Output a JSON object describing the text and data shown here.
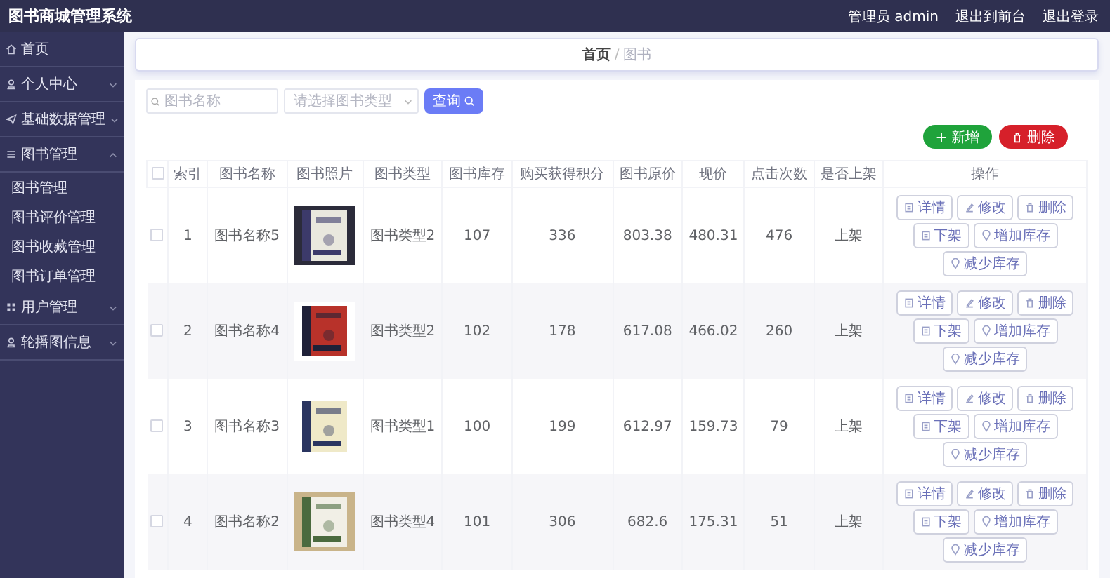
{
  "header": {
    "title": "图书商城管理系统",
    "links": [
      "管理员 admin",
      "退出到前台",
      "退出登录"
    ]
  },
  "sidebar": {
    "items": [
      {
        "label": "首页"
      },
      {
        "label": "个人中心",
        "expanded": false
      },
      {
        "label": "基础数据管理",
        "expanded": false
      },
      {
        "label": "图书管理",
        "expanded": true,
        "children": [
          {
            "label": "图书管理"
          },
          {
            "label": "图书评价管理"
          },
          {
            "label": "图书收藏管理"
          },
          {
            "label": "图书订单管理"
          }
        ]
      },
      {
        "label": "用户管理",
        "expanded": false
      },
      {
        "label": "轮播图信息",
        "expanded": false
      }
    ]
  },
  "breadcrumb": {
    "items": [
      "首页",
      "图书"
    ],
    "separator": "/"
  },
  "search": {
    "name_placeholder": "图书名称",
    "type_placeholder": "请选择图书类型",
    "button": "查询"
  },
  "actions": [
    "新增",
    "删除"
  ],
  "table": {
    "columns": [
      "索引",
      "图书名称",
      "图书照片",
      "图书类型",
      "图书库存",
      "购买获得积分",
      "图书原价",
      "现价",
      "点击次数",
      "是否上架",
      "操作"
    ],
    "header_checked": false,
    "rows": [
      {
        "checked": false,
        "cells": [
          "1",
          "图书名称5",
          {
            "kind": "picture"
          },
          "图书类型2",
          "107",
          "336",
          "803.38",
          "480.31",
          "476",
          "上架"
        ],
        "buttons": [
          "详情",
          "修改",
          "删除",
          "下架",
          "增加库存",
          "减少库存"
        ]
      },
      {
        "checked": false,
        "cells": [
          "2",
          "图书名称4",
          {
            "kind": "picture"
          },
          "图书类型2",
          "102",
          "178",
          "617.08",
          "466.02",
          "260",
          "上架"
        ],
        "buttons": [
          "详情",
          "修改",
          "删除",
          "下架",
          "增加库存",
          "减少库存"
        ]
      },
      {
        "checked": false,
        "cells": [
          "3",
          "图书名称3",
          {
            "kind": "picture"
          },
          "图书类型1",
          "100",
          "199",
          "612.97",
          "159.73",
          "79",
          "上架"
        ],
        "buttons": [
          "详情",
          "修改",
          "删除",
          "下架",
          "增加库存",
          "减少库存"
        ]
      },
      {
        "checked": false,
        "cells": [
          "4",
          "图书名称2",
          {
            "kind": "picture"
          },
          "图书类型4",
          "101",
          "306",
          "682.6",
          "175.31",
          "51",
          "上架"
        ],
        "buttons": [
          "详情",
          "修改",
          "删除",
          "下架",
          "增加库存",
          "减少库存"
        ]
      }
    ]
  }
}
